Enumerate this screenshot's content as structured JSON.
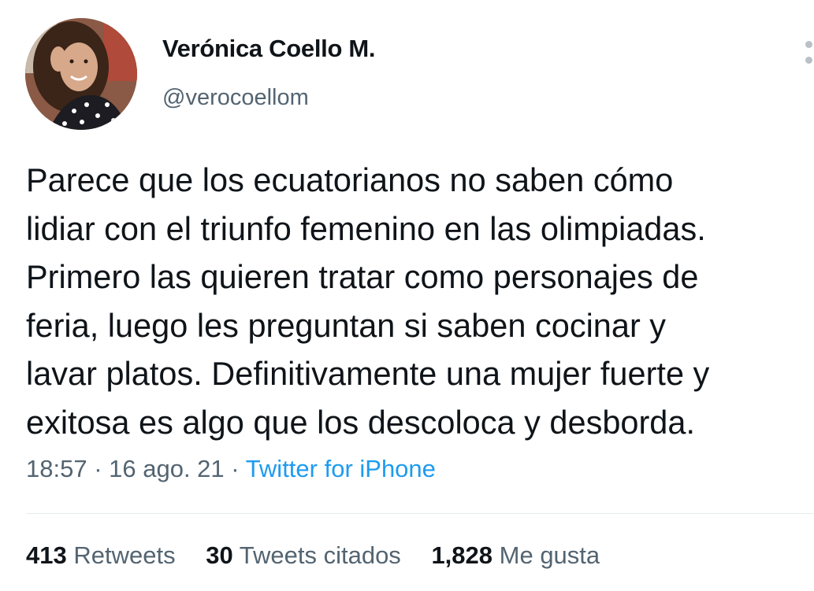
{
  "author": {
    "display_name": "Verónica Coello M.",
    "handle": "@verocoellom"
  },
  "tweet": {
    "lines": [
      "Parece que los ecuatorianos no saben cómo",
      "lidiar con el triunfo femenino en las olimpiadas.",
      "Primero las quieren tratar como personajes de",
      "feria, luego les preguntan si saben cocinar y",
      "lavar platos. Definitivamente una mujer fuerte y",
      "exitosa es algo que los descoloca y desborda."
    ],
    "time": "18:57",
    "date": "16 ago. 21",
    "source": "Twitter for iPhone"
  },
  "stats": {
    "retweets_count": "413",
    "retweets_label": "Retweets",
    "quotes_count": "30",
    "quotes_label": "Tweets citados",
    "likes_count": "1,828",
    "likes_label": "Me gusta"
  },
  "icons": {
    "more": "more-vertical-icon"
  }
}
